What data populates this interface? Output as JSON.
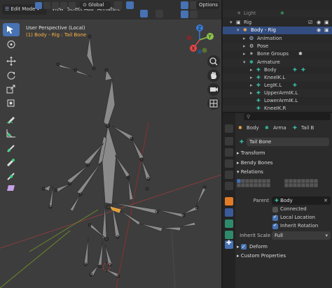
{
  "colors": {
    "accent": "#4772b3",
    "selection_text": "#ffb347",
    "bone_icon": "#38c0a8",
    "armature_icon": "#2ec4a0"
  },
  "viewport": {
    "header": {
      "mode_label": "Edit Mode",
      "menus": [
        "View",
        "Select",
        "Add",
        "Armature"
      ],
      "transform_orientation": "Global",
      "options_label": "Options"
    },
    "overlay": {
      "perspective_label": "User Perspective (Local)",
      "selection_label": "(1) Body - Rig : Tail Bone"
    },
    "gizmo": {
      "z": "Z",
      "y": "Y",
      "x": "X"
    },
    "nav_icons": [
      "zoom-icon",
      "hand-pan-icon",
      "camera-icon",
      "grid-icon"
    ]
  },
  "outliner": {
    "rows": [
      {
        "label": "Light",
        "kind": "light"
      },
      {
        "label": "Rig",
        "kind": "collection"
      },
      {
        "label": "Body - Rig",
        "kind": "object",
        "selected": true
      },
      {
        "label": "Animation",
        "kind": "animation"
      },
      {
        "label": "Pose",
        "kind": "pose"
      },
      {
        "label": "Bone Groups",
        "kind": "group"
      },
      {
        "label": "Armature",
        "kind": "armature"
      },
      {
        "label": "Body",
        "kind": "bone"
      },
      {
        "label": "KneelK.L",
        "kind": "bone"
      },
      {
        "label": "LegIK.L",
        "kind": "bone"
      },
      {
        "label": "UpperArmIK.L",
        "kind": "bone"
      },
      {
        "label": "LowerArmIK.L",
        "kind": "bone"
      },
      {
        "label": "KneeIK.R",
        "kind": "bone"
      }
    ]
  },
  "properties": {
    "search_placeholder": "",
    "breadcrumb": [
      "Body",
      "Arma",
      "Tail B"
    ],
    "bone_name": "Tail Bone",
    "panels": {
      "transform": "Transform",
      "bendy_bones": "Bendy Bones",
      "relations": "Relations",
      "deform": "Deform",
      "custom_properties": "Custom Properties"
    },
    "relations": {
      "parent_label": "Parent",
      "parent_value": "Body",
      "connected_label": "Connected",
      "connected": false,
      "local_location_label": "Local Location",
      "local_location": true,
      "inherit_rotation_label": "Inherit Rotation",
      "inherit_rotation": true,
      "inherit_scale_label": "Inherit Scale",
      "inherit_scale_value": "Full"
    },
    "deform_enabled": true
  }
}
